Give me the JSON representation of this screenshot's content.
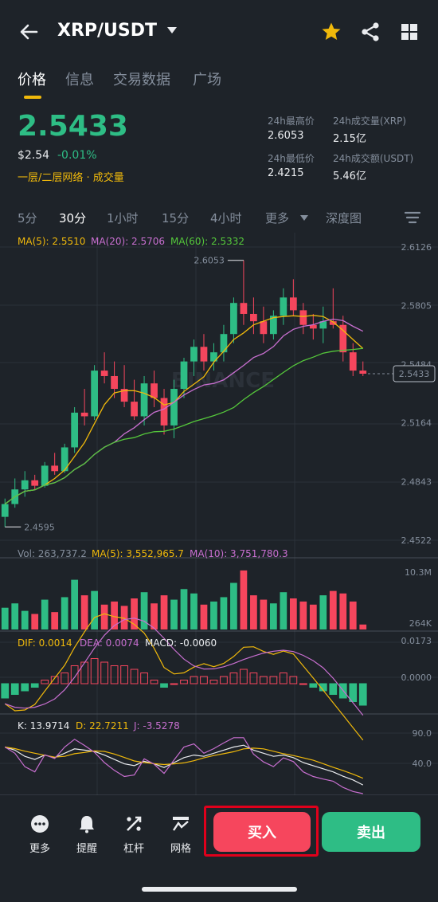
{
  "header": {
    "pair": "XRP/USDT",
    "icons": [
      "back-arrow-icon",
      "star-icon",
      "share-icon",
      "grid-icon"
    ],
    "star_color": "#f0b90b"
  },
  "tabs": [
    {
      "label": "价格",
      "active": true
    },
    {
      "label": "信息",
      "active": false
    },
    {
      "label": "交易数据",
      "active": false
    },
    {
      "label": "广场",
      "active": false
    }
  ],
  "price": {
    "last": "2.5433",
    "usd": "$2.54",
    "change": "-0.01%",
    "tags": "一层/二层网络 · 成交量",
    "color": "#2ebd85"
  },
  "stats": {
    "high_label": "24h最高价",
    "high": "2.6053",
    "vol_xrp_label": "24h成交量(XRP)",
    "vol_xrp": "2.15亿",
    "low_label": "24h最低价",
    "low": "2.4215",
    "vol_usdt_label": "24h成交额(USDT)",
    "vol_usdt": "5.46亿"
  },
  "intervals": [
    {
      "label": "5分",
      "active": false
    },
    {
      "label": "30分",
      "active": true
    },
    {
      "label": "1小时",
      "active": false
    },
    {
      "label": "15分",
      "active": false
    },
    {
      "label": "4小时",
      "active": false
    },
    {
      "label": "更多",
      "active": false
    },
    {
      "label": "深度图",
      "active": false
    }
  ],
  "ma_legend": {
    "ma5": "MA(5): 2.5510",
    "ma20": "MA(20): 2.5706",
    "ma60": "MA(60): 2.5332"
  },
  "vol_legend": {
    "vol": "Vol: 263,737.2",
    "ma5": "MA(5): 3,552,965.7",
    "ma10": "MA(10): 3,751,780.3"
  },
  "macd_legend": {
    "dif": "DIF: 0.0014",
    "dea": "DEA: 0.0074",
    "macd": "MACD: -0.0060"
  },
  "kdj_legend": {
    "k": "K: 13.9714",
    "d": "D: 22.7211",
    "j": "J: -3.5278"
  },
  "chart_data": {
    "type": "candlestick",
    "price_axis": [
      "2.6126",
      "2.5805",
      "2.5484",
      "2.5164",
      "2.4843",
      "2.4522"
    ],
    "ylim": [
      2.4522,
      2.6126
    ],
    "last_price_tag": "2.5433",
    "high_marker": "2.6053",
    "low_marker": "2.4595",
    "vol_axis": [
      "10.3M",
      "264K"
    ],
    "macd_axis": [
      "0.0173",
      "0.0000"
    ],
    "kdj_axis": [
      "90.0",
      "40.0"
    ],
    "colors": {
      "up": "#2ebd85",
      "down": "#f6465d",
      "ma5": "#f0b90b",
      "ma20": "#c86fd0",
      "ma60": "#55c83b"
    },
    "candles": [
      [
        2.465,
        2.475,
        2.4595,
        2.472
      ],
      [
        2.472,
        2.486,
        2.47,
        2.48
      ],
      [
        2.48,
        2.49,
        2.476,
        2.485
      ],
      [
        2.485,
        2.488,
        2.48,
        2.482
      ],
      [
        2.482,
        2.495,
        2.481,
        2.493
      ],
      [
        2.493,
        2.5,
        2.488,
        2.49
      ],
      [
        2.49,
        2.505,
        2.489,
        2.503
      ],
      [
        2.503,
        2.525,
        2.5,
        2.522
      ],
      [
        2.522,
        2.535,
        2.515,
        2.52
      ],
      [
        2.52,
        2.548,
        2.518,
        2.545
      ],
      [
        2.545,
        2.555,
        2.538,
        2.542
      ],
      [
        2.542,
        2.55,
        2.53,
        2.535
      ],
      [
        2.535,
        2.548,
        2.525,
        2.528
      ],
      [
        2.528,
        2.54,
        2.518,
        2.52
      ],
      [
        2.52,
        2.542,
        2.515,
        2.538
      ],
      [
        2.538,
        2.545,
        2.525,
        2.53
      ],
      [
        2.53,
        2.535,
        2.51,
        2.515
      ],
      [
        2.515,
        2.54,
        2.508,
        2.535
      ],
      [
        2.535,
        2.552,
        2.53,
        2.55
      ],
      [
        2.55,
        2.562,
        2.542,
        2.558
      ],
      [
        2.558,
        2.565,
        2.545,
        2.55
      ],
      [
        2.55,
        2.56,
        2.545,
        2.555
      ],
      [
        2.555,
        2.57,
        2.55,
        2.565
      ],
      [
        2.565,
        2.585,
        2.56,
        2.582
      ],
      [
        2.582,
        2.6053,
        2.57,
        2.576
      ],
      [
        2.576,
        2.585,
        2.565,
        2.572
      ],
      [
        2.572,
        2.58,
        2.56,
        2.565
      ],
      [
        2.565,
        2.578,
        2.562,
        2.575
      ],
      [
        2.575,
        2.59,
        2.57,
        2.585
      ],
      [
        2.585,
        2.595,
        2.575,
        2.578
      ],
      [
        2.578,
        2.582,
        2.565,
        2.57
      ],
      [
        2.57,
        2.576,
        2.562,
        2.568
      ],
      [
        2.568,
        2.58,
        2.56,
        2.572
      ],
      [
        2.572,
        2.59,
        2.568,
        2.57
      ],
      [
        2.57,
        2.575,
        2.55,
        2.555
      ],
      [
        2.555,
        2.56,
        2.542,
        2.545
      ],
      [
        2.545,
        2.55,
        2.542,
        2.5433
      ]
    ],
    "volumes": [
      0.35,
      0.42,
      0.3,
      0.25,
      0.48,
      0.28,
      0.52,
      0.8,
      0.55,
      0.62,
      0.4,
      0.45,
      0.38,
      0.5,
      0.6,
      0.42,
      0.55,
      0.48,
      0.65,
      0.58,
      0.4,
      0.45,
      0.52,
      0.75,
      0.95,
      0.55,
      0.48,
      0.42,
      0.6,
      0.5,
      0.45,
      0.4,
      0.55,
      0.62,
      0.58,
      0.45,
      0.08
    ],
    "macd_hist": [
      -0.004,
      -0.003,
      -0.002,
      -0.001,
      0.001,
      0.002,
      0.003,
      0.005,
      0.006,
      0.007,
      0.006,
      0.005,
      0.005,
      0.004,
      0.003,
      0.001,
      -0.001,
      0.0,
      0.001,
      0.002,
      0.002,
      0.001,
      0.002,
      0.003,
      0.004,
      0.003,
      0.002,
      0.002,
      0.003,
      0.002,
      0.0,
      -0.001,
      -0.002,
      -0.003,
      -0.004,
      -0.005,
      -0.006
    ],
    "kdj_k": [
      75,
      70,
      60,
      55,
      62,
      58,
      65,
      72,
      70,
      68,
      62,
      55,
      48,
      45,
      52,
      48,
      42,
      50,
      58,
      62,
      60,
      65,
      70,
      75,
      78,
      70,
      65,
      60,
      62,
      58,
      50,
      45,
      40,
      35,
      28,
      22,
      14
    ]
  },
  "bottom_bar": {
    "items": [
      {
        "label": "更多",
        "icon": "more-icon"
      },
      {
        "label": "提醒",
        "icon": "bell-icon"
      },
      {
        "label": "杠杆",
        "icon": "leverage-icon"
      },
      {
        "label": "网格",
        "icon": "grid-trading-icon"
      }
    ],
    "buy": "买入",
    "sell": "卖出"
  }
}
